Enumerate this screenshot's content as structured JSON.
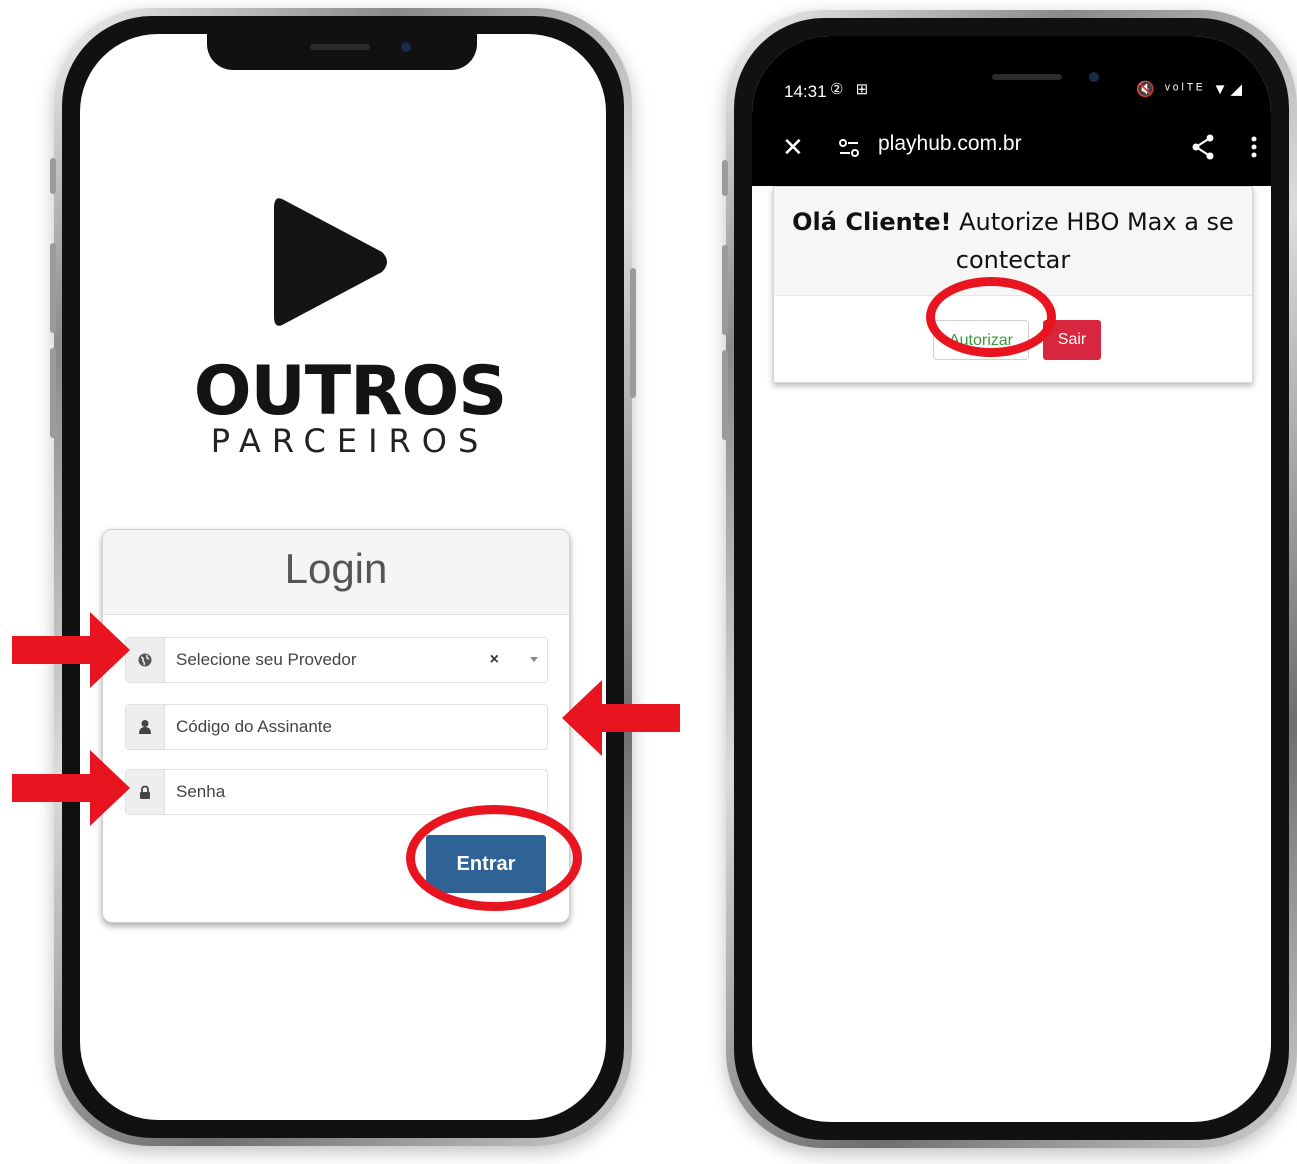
{
  "phone_left": {
    "logo": {
      "line1": "OUTROS",
      "line2": "PARCEIROS"
    },
    "login": {
      "title": "Login",
      "provider_placeholder": "Selecione seu Provedor",
      "provider_clear": "×",
      "subscriber_placeholder": "Código do Assinante",
      "password_placeholder": "Senha",
      "submit_label": "Entrar"
    }
  },
  "phone_right": {
    "status": {
      "time": "14:31",
      "left_icons": "② ⊞",
      "right_icons": "🔇 ᵛᵒˡᵀᴱ ▼◢"
    },
    "browser": {
      "close": "✕",
      "url": "playhub.com.br"
    },
    "auth": {
      "greeting_bold": "Olá Cliente!",
      "message": "Autorize HBO Max a se contectar",
      "authorize_label": "Autorizar",
      "exit_label": "Sair"
    }
  },
  "colors": {
    "annotation_red": "#e8141f",
    "entrar_blue": "#2f6396",
    "sair_red": "#d7263d",
    "autorizar_green": "#3a9a3a"
  }
}
